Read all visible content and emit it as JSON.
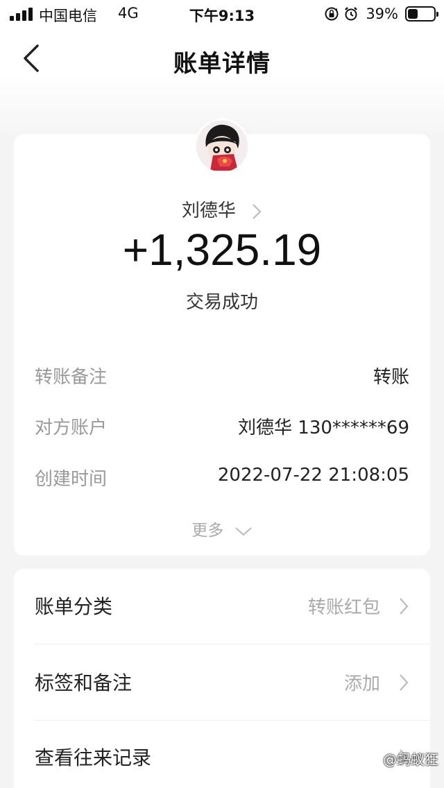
{
  "status_bar": {
    "carrier": "中国电信",
    "network": "4G",
    "time": "下午9:13",
    "battery_pct": "39%",
    "battery_level": 0.39,
    "icons": [
      "signal-icon",
      "rotation-lock-icon",
      "alarm-icon",
      "battery-icon"
    ]
  },
  "nav": {
    "title": "账单详情",
    "back_icon": "chevron-left-icon"
  },
  "bill": {
    "name": "刘德华",
    "amount": "+1,325.19",
    "status": "交易成功",
    "details": [
      {
        "key": "转账备注",
        "value": "转账"
      },
      {
        "key": "对方账户",
        "value": "刘德华 130******69"
      },
      {
        "key": "创建时间",
        "value": "2022-07-22 21:08:05"
      }
    ],
    "more_label": "更多"
  },
  "options": [
    {
      "label": "账单分类",
      "value": "转账红包"
    },
    {
      "label": "标签和备注",
      "value": "添加"
    },
    {
      "label": "查看往来记录",
      "value": ""
    }
  ],
  "watermark": "@蚂蚁狂"
}
